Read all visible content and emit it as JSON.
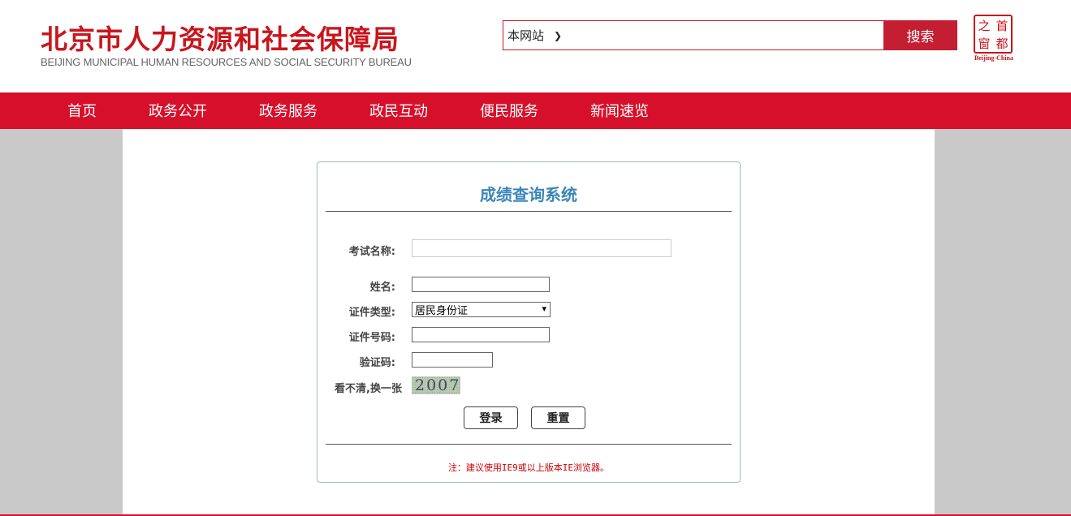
{
  "header": {
    "logo_cn": "北京市人力资源和社会保障局",
    "logo_en": "BEIJING MUNICIPAL HUMAN RESOURCES AND SOCIAL SECURITY BUREAU",
    "search": {
      "scope_value": "本网站",
      "input_value": "",
      "button_label": "搜索"
    },
    "seal": {
      "chars": [
        "之",
        "首",
        "窗",
        "都"
      ],
      "caption": "Beijing-China"
    }
  },
  "nav": {
    "items": [
      "首页",
      "政务公开",
      "政务服务",
      "政民互动",
      "便民服务",
      "新闻速览"
    ]
  },
  "form": {
    "title": "成绩查询系统",
    "exam_name_label": "考试名称:",
    "exam_name_value": "",
    "name_label": "姓名:",
    "name_value": "",
    "id_type_label": "证件类型:",
    "id_type_value": "居民身份证",
    "id_number_label": "证件号码:",
    "id_number_value": "",
    "captcha_label": "验证码:",
    "captcha_value": "",
    "captcha_refresh_label": "看不清,换一张",
    "captcha_image_text": "2007",
    "login_label": "登录",
    "reset_label": "重置",
    "note": "注：建议使用IE9或以上版本IE浏览器。"
  },
  "colors": {
    "brand_red": "#d6102a",
    "title_blue": "#3a86b8",
    "note_red": "#cc0000"
  }
}
